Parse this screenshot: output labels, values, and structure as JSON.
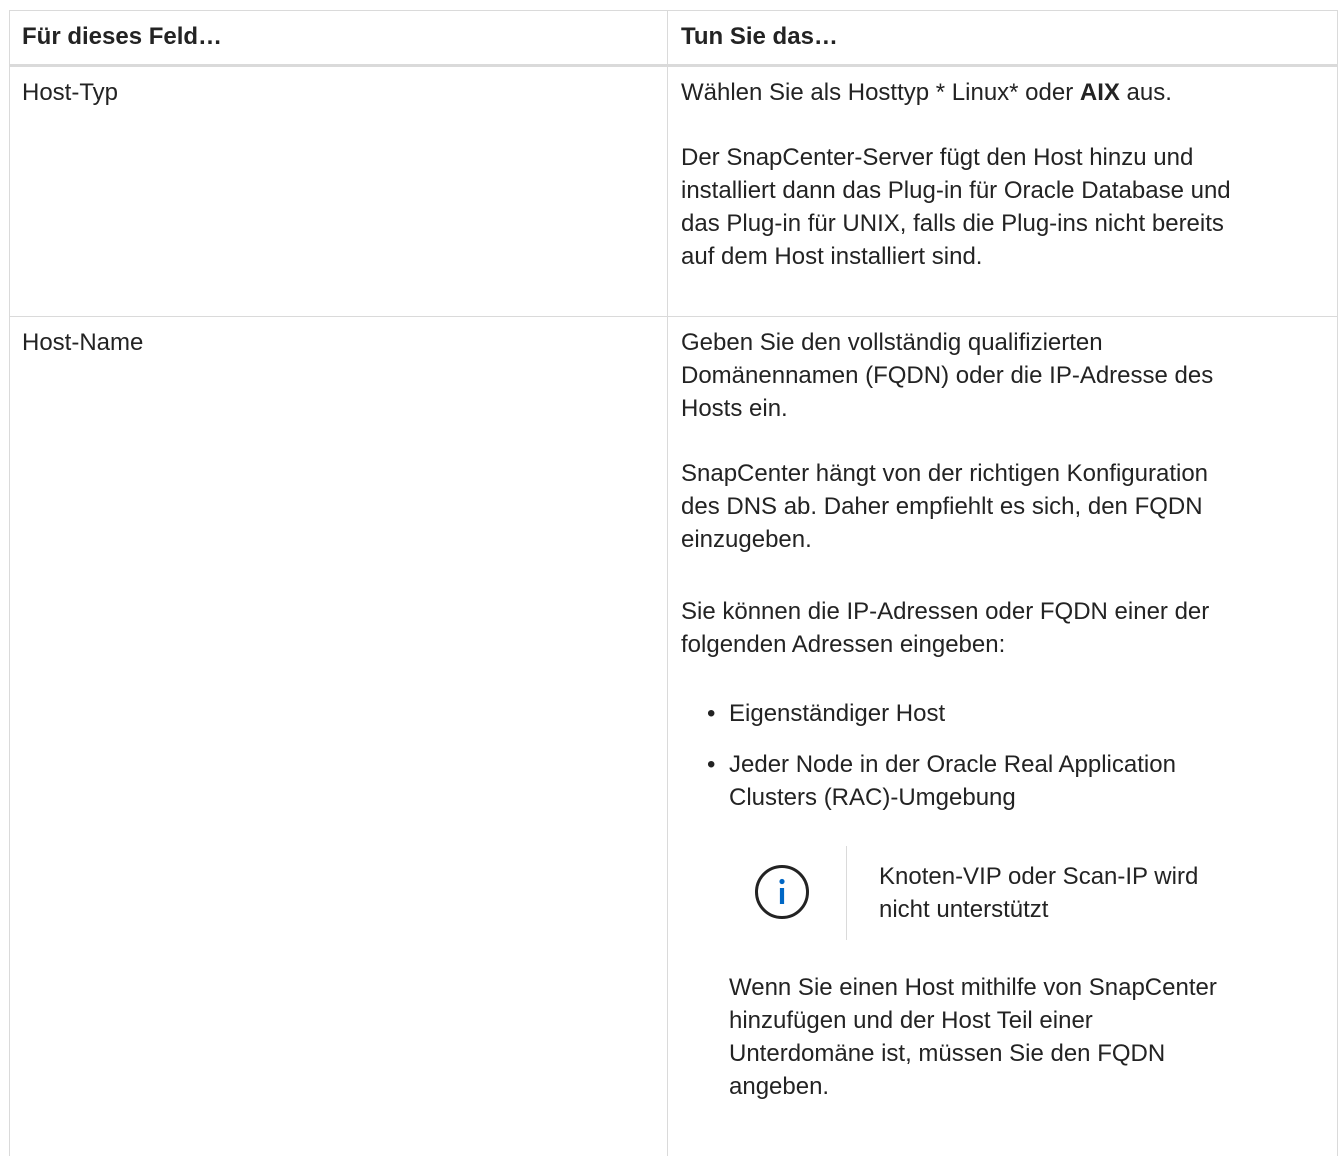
{
  "header": {
    "col1": "Für dieses Feld…",
    "col2": "Tun Sie das…"
  },
  "rows": [
    {
      "field": "Host-Typ",
      "desc": {
        "p1_before": "Wählen Sie als Hosttyp * Linux* oder ",
        "p1_bold": "AIX",
        "p1_after": " aus.",
        "p2_line1": "Der SnapCenter-Server fügt den Host hinzu und",
        "p2_line2": "installiert dann das Plug-in für Oracle Database und",
        "p2_line3": "das Plug-in für UNIX, falls die Plug-ins nicht bereits",
        "p2_line4": "auf dem Host installiert sind."
      }
    },
    {
      "field": "Host-Name",
      "desc": {
        "p1_line1": "Geben Sie den vollständig qualifizierten",
        "p1_line2": "Domänennamen (FQDN) oder die IP-Adresse des",
        "p1_line3": "Hosts ein.",
        "p2_line1": "SnapCenter hängt von der richtigen Konfiguration",
        "p2_line2": "des DNS ab. Daher empfiehlt es sich, den FQDN",
        "p2_line3": "einzugeben.",
        "p3_line1": "Sie können die IP-Adressen oder FQDN einer der",
        "p3_line2": "folgenden Adressen eingeben:",
        "bullets": [
          {
            "line1": "Eigenständiger Host"
          },
          {
            "line1": "Jeder Node in der Oracle Real Application",
            "line2": "Clusters (RAC)-Umgebung"
          }
        ],
        "note_line1": "Knoten-VIP oder Scan-IP wird",
        "note_line2": "nicht unterstützt",
        "p4_line1": "Wenn Sie einen Host mithilfe von SnapCenter",
        "p4_line2": "hinzufügen und der Host Teil einer",
        "p4_line3": "Unterdomäne ist, müssen Sie den FQDN",
        "p4_line4": "angeben."
      }
    }
  ],
  "icons": {
    "info": "info-circle-icon",
    "info_color": "#0067c5"
  }
}
